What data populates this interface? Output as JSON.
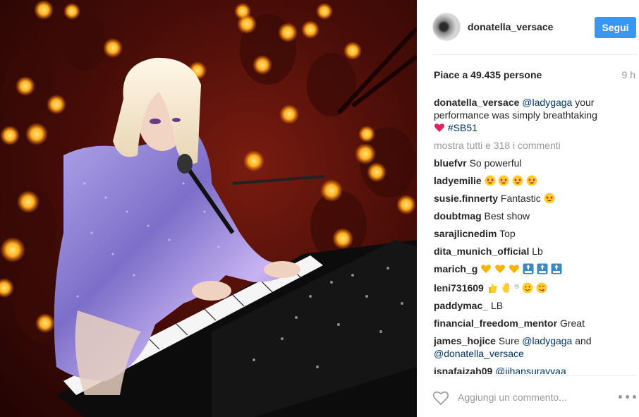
{
  "post": {
    "image_alt": "",
    "author": "donatella_versace",
    "follow_label": "Segui",
    "likes_text": "Piace a 49.435 persone",
    "time_ago": "9 h"
  },
  "caption": {
    "user": "donatella_versace",
    "mention": "@ladygaga",
    "text": " your performance was simply breathtaking ",
    "hashtag": "#SB51"
  },
  "show_all_label": "mostra tutti e 318 i commenti",
  "comments": [
    {
      "user": "bluefvr",
      "text": "So powerful"
    },
    {
      "user": "ladyemilie",
      "text": ""
    },
    {
      "user": "susie.finnerty",
      "text": "Fantastic"
    },
    {
      "user": "doubtmag",
      "text": "Best show"
    },
    {
      "user": "sarajlicnedim",
      "text": "Top"
    },
    {
      "user": "dita_munich_official",
      "text": "Lb"
    },
    {
      "user": "marich_g",
      "text": ""
    },
    {
      "user": "leni731609",
      "text": ""
    },
    {
      "user": "paddymac_",
      "text": "LB"
    },
    {
      "user": "financial_freedom_mentor",
      "text": "Great"
    },
    {
      "user": "james_hojice",
      "text": "Sure ",
      "mention": "@ladygaga",
      "text2": " and",
      "mention2": "@donatella_versace"
    },
    {
      "user": "isnafaizah09",
      "text": "",
      "mention": "@jihansurayyaa"
    }
  ],
  "footer": {
    "comment_placeholder": "Aggiungi un commento..."
  },
  "colors": {
    "accent": "#3897f0",
    "mention": "#003569",
    "heart": "#e0245e"
  }
}
